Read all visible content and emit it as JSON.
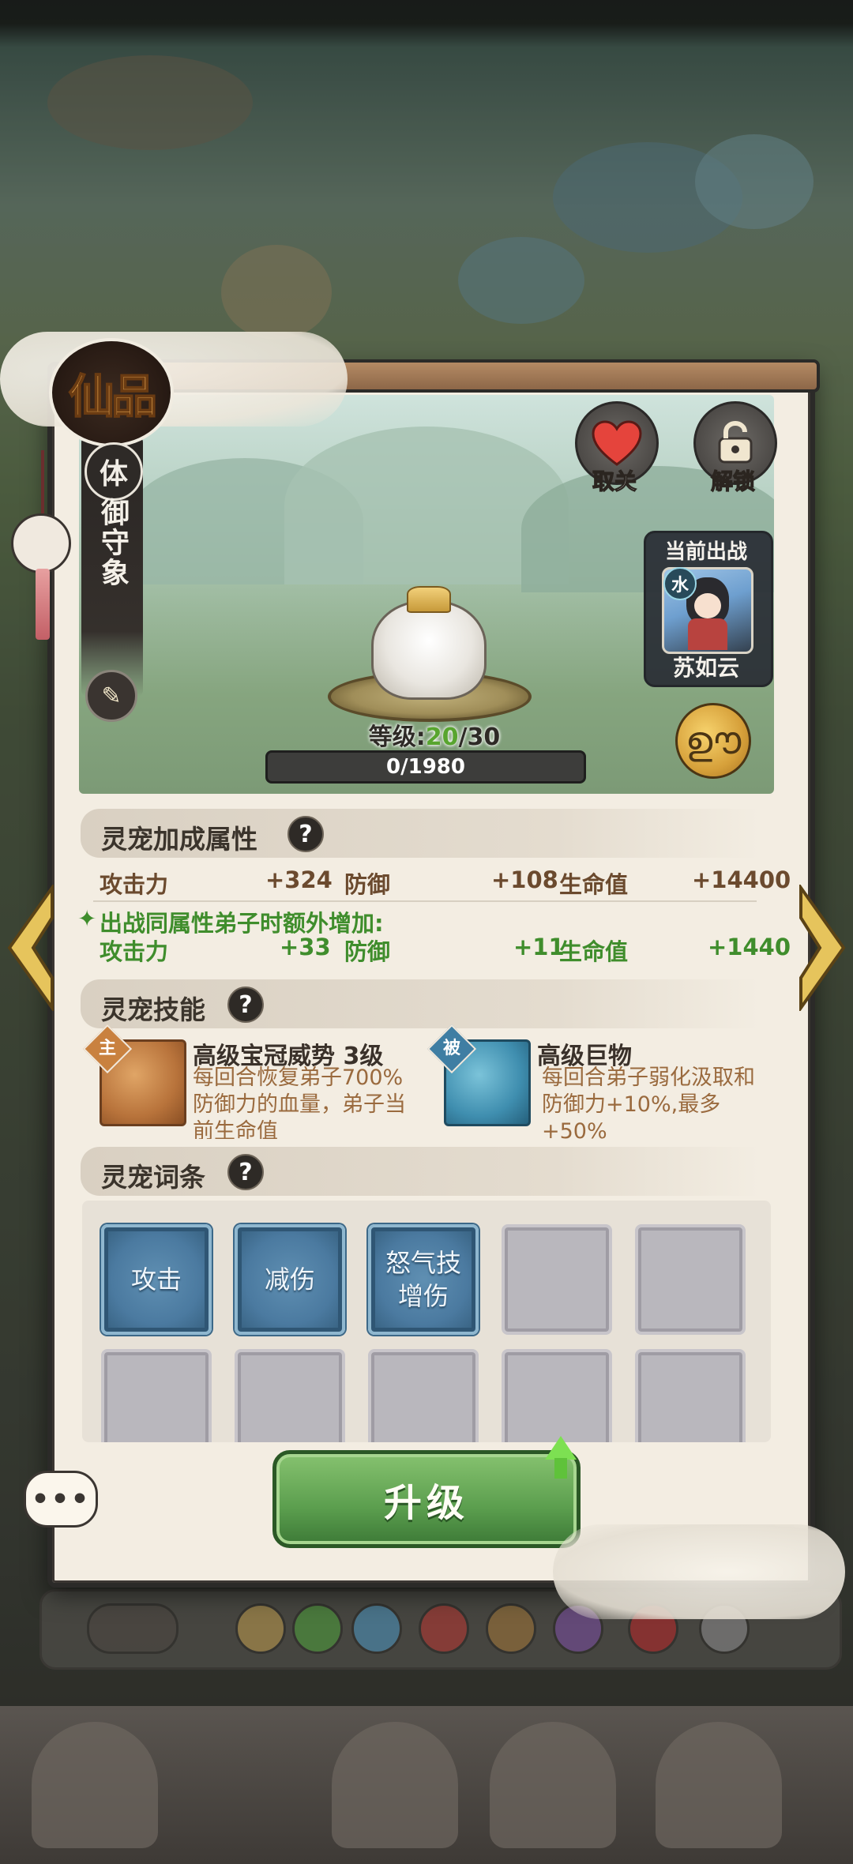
{
  "grade": "仙品",
  "pet": {
    "type": "体",
    "name": "御守象"
  },
  "actions": {
    "like_label": "取关",
    "unlock_label": "解锁"
  },
  "current_battle": {
    "title": "当前出战",
    "element": "水",
    "character": "苏如云"
  },
  "level": {
    "prefix": "等级:",
    "current": "20",
    "max": "/30",
    "exp": "0/1980"
  },
  "bonus": {
    "title": "灵宠加成属性",
    "help": "?",
    "stats": [
      {
        "name": "攻击力",
        "value": "+324"
      },
      {
        "name": "防御",
        "value": "+108"
      },
      {
        "name": "生命值",
        "value": "+14400"
      }
    ],
    "extra_title": "出战同属性弟子时额外增加:",
    "extra_stats": [
      {
        "name": "攻击力",
        "value": "+33"
      },
      {
        "name": "防御",
        "value": "+11"
      },
      {
        "name": "生命值",
        "value": "+1440"
      }
    ]
  },
  "skills": {
    "title": "灵宠技能",
    "help": "?",
    "items": [
      {
        "tag": "主",
        "name": "高级宝冠威势 3级",
        "desc": "每回合恢复弟子700%防御力的血量，弟子当前生命值",
        "tag_color": "#c9813f"
      },
      {
        "tag": "被",
        "name": "高级巨物",
        "desc": "每回合弟子弱化汲取和防御力+10%,最多+50%",
        "tag_color": "#3f7ea3"
      }
    ]
  },
  "traits": {
    "title": "灵宠词条",
    "help": "?",
    "slots": [
      "攻击",
      "减伤",
      "怒气技\n增伤",
      "",
      "",
      "",
      "",
      "",
      "",
      ""
    ]
  },
  "upgrade_label": "升级",
  "chat_label": "•••",
  "colors": {
    "accent_green": "#58a52f",
    "stat_brown": "#6b4a2e",
    "stat_green": "#3f8d2c",
    "panel": "#f3ede2"
  }
}
